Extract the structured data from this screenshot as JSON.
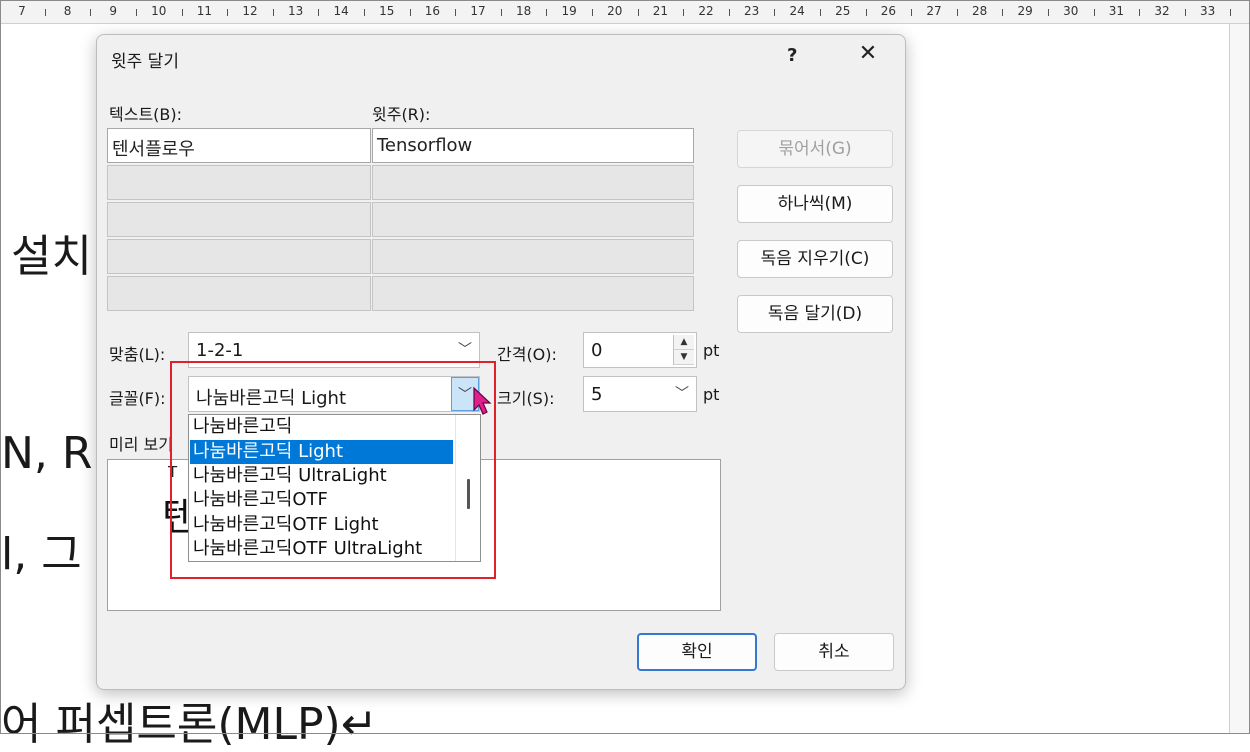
{
  "ruler": {
    "numbers": [
      "7",
      "8",
      "9",
      "10",
      "11",
      "12",
      "13",
      "14",
      "15",
      "16",
      "17",
      "18",
      "19",
      "20",
      "21",
      "22",
      "23",
      "24",
      "25",
      "26",
      "27",
      "28",
      "29",
      "30",
      "31",
      "32",
      "33"
    ]
  },
  "document": {
    "lines": [
      "설치",
      "N, RN",
      "l, 그",
      "어  퍼셉트론(MLP)↵"
    ]
  },
  "dialog": {
    "title": "윗주 달기",
    "help_label": "?",
    "close_label": "✕",
    "text_column_label": "텍스트(B):",
    "ruby_column_label": "윗주(R):",
    "rows": [
      {
        "text": "텐서플로우",
        "ruby": "Tensorflow"
      },
      {
        "text": "",
        "ruby": ""
      },
      {
        "text": "",
        "ruby": ""
      },
      {
        "text": "",
        "ruby": ""
      },
      {
        "text": "",
        "ruby": ""
      }
    ],
    "buttons": {
      "group": "묶어서(G)",
      "mono": "하나씩(M)",
      "clear": "독음 지우기(C)",
      "reading": "독음 달기(D)",
      "ok": "확인",
      "cancel": "취소"
    },
    "alignment": {
      "label": "맞춤(L):",
      "value": "1-2-1"
    },
    "offset": {
      "label": "간격(O):",
      "value": "0",
      "unit": "pt"
    },
    "font": {
      "label": "글꼴(F):",
      "value": "나눔바른고딕 Light"
    },
    "size": {
      "label": "크기(S):",
      "value": "5",
      "unit": "pt"
    },
    "preview_label": "미리 보기",
    "preview": {
      "ruby": "T",
      "base": "텐"
    },
    "font_options": [
      "나눔바른고딕",
      "나눔바른고딕 Light",
      "나눔바른고딕 UltraLight",
      "나눔바른고딕OTF",
      "나눔바른고딕OTF Light",
      "나눔바른고딕OTF UltraLight"
    ],
    "font_selected_index": 1
  },
  "colors": {
    "highlight": "#e0202a",
    "selection": "#0078d7",
    "primary_border": "#3478d4",
    "cursor": "#e0208a"
  }
}
